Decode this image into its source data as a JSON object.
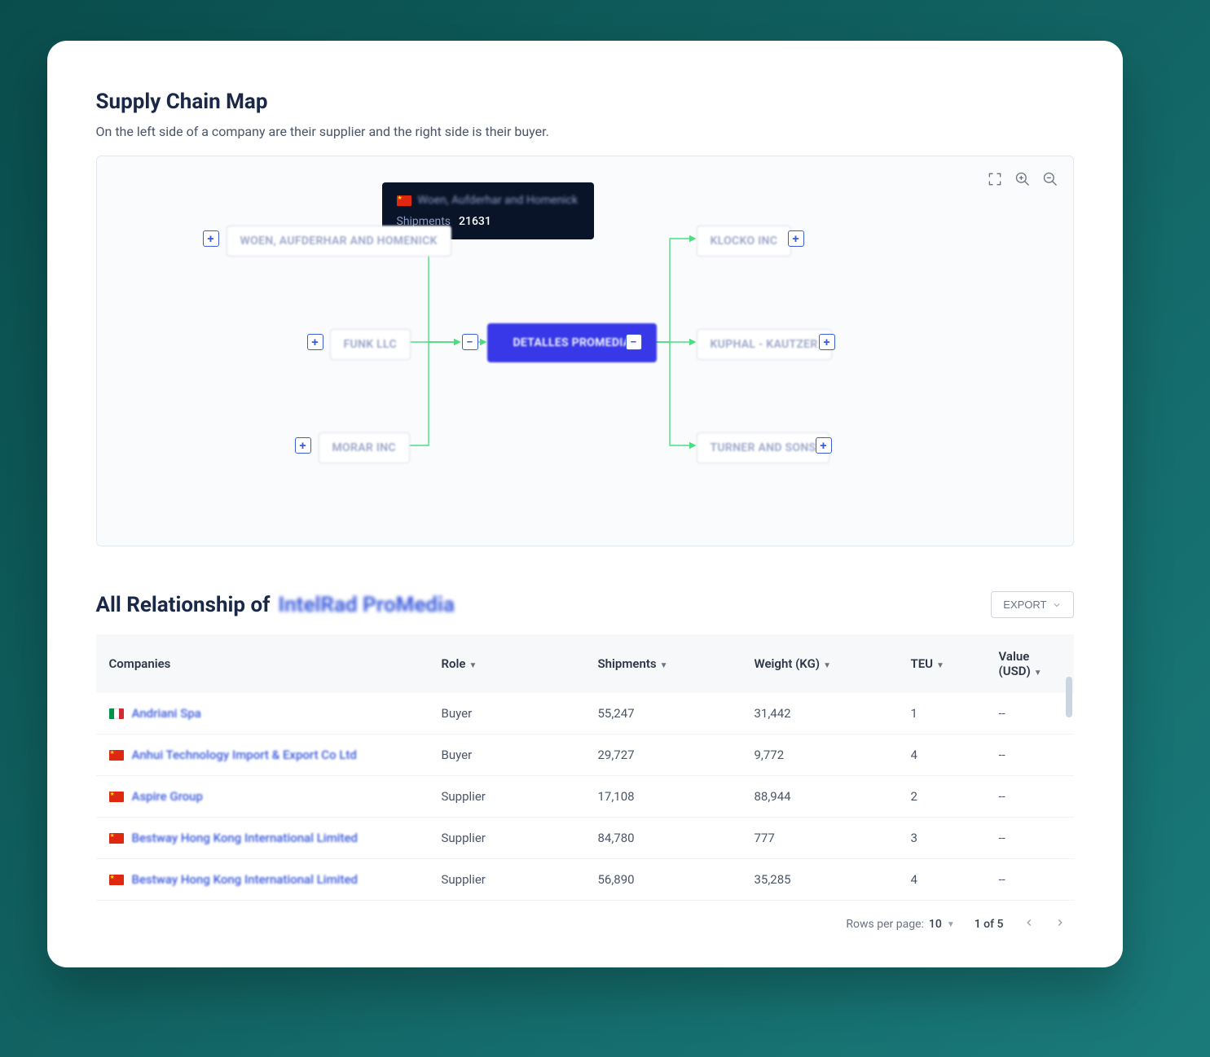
{
  "supply_chain": {
    "title": "Supply Chain Map",
    "subtitle": "On the left side of a company are their supplier and the right side is their buyer.",
    "center_node": "DETALLES PROMEDIA",
    "suppliers": [
      "WOEN, AUFDERHAR AND HOMENICK",
      "FUNK LLC",
      "MORAR INC"
    ],
    "buyers": [
      "KLOCKO INC",
      "KUPHAL - KAUTZER",
      "TURNER AND SONS"
    ],
    "tooltip": {
      "company": "Woen, Aufderhar and Homenick",
      "shipments_label": "Shipments",
      "shipments_value": "21631"
    },
    "expand_plus": "+",
    "collapse_minus": "−"
  },
  "relationship": {
    "title_prefix": "All Relationship of",
    "company": "IntelRad ProMedia",
    "export_label": "EXPORT",
    "columns": {
      "companies": "Companies",
      "role": "Role",
      "shipments": "Shipments",
      "weight": "Weight (KG)",
      "teu": "TEU",
      "value": "Value (USD)"
    },
    "rows": [
      {
        "flag": "it",
        "company": "Andriani Spa",
        "role": "Buyer",
        "shipments": "55,247",
        "weight": "31,442",
        "teu": "1",
        "value": "--"
      },
      {
        "flag": "cn",
        "company": "Anhui Technology Import & Export Co Ltd",
        "role": "Buyer",
        "shipments": "29,727",
        "weight": "9,772",
        "teu": "4",
        "value": "--"
      },
      {
        "flag": "cn",
        "company": "Aspire Group",
        "role": "Supplier",
        "shipments": "17,108",
        "weight": "88,944",
        "teu": "2",
        "value": "--"
      },
      {
        "flag": "cn",
        "company": "Bestway Hong Kong International Limited",
        "role": "Supplier",
        "shipments": "84,780",
        "weight": "777",
        "teu": "3",
        "value": "--"
      },
      {
        "flag": "cn",
        "company": "Bestway Hong Kong International Limited",
        "role": "Supplier",
        "shipments": "56,890",
        "weight": "35,285",
        "teu": "4",
        "value": "--"
      }
    ],
    "pagination": {
      "rows_label": "Rows per page:",
      "rows_value": "10",
      "page_text": "1 of 5"
    }
  }
}
